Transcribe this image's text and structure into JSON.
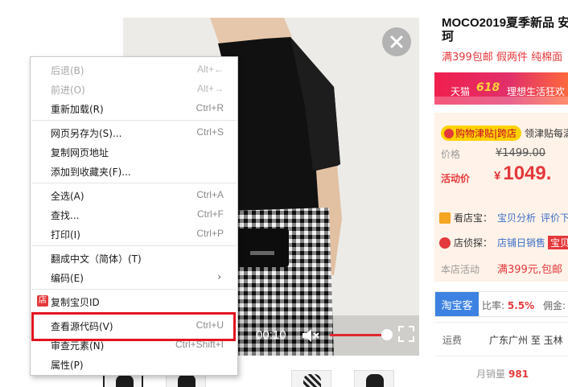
{
  "product": {
    "title": "MOCO2019夏季新品 安珂",
    "subtitle": "满399包邮 假两件 纯棉面"
  },
  "video": {
    "time": "00:10",
    "volume_level": 0.82
  },
  "banner": {
    "tmall": "天猫",
    "logo": "618",
    "slogan": "理想生活狂欢"
  },
  "coupon": {
    "tag": "购物津贴|跨店",
    "tail": "领津贴每满"
  },
  "prices": {
    "price_label": "价格",
    "original": "¥1499.00",
    "activity_label": "活动价",
    "currency": "¥",
    "activity_price": "1049."
  },
  "services": [
    {
      "label": "看店宝：",
      "links": [
        "宝贝分析",
        "评价下"
      ],
      "badge": ""
    },
    {
      "label": "店侦探：",
      "links": [
        "店铺日销售"
      ],
      "badge": "宝贝"
    }
  ],
  "shop_activity": {
    "label": "本店活动",
    "value": "满399元,包邮"
  },
  "taoke": {
    "button": "淘宝客",
    "ratio_label": "比率:",
    "ratio_value": "5.5%",
    "commission_label": "佣金:"
  },
  "shipping": {
    "label": "运费",
    "value": "广东广州 至 玉林"
  },
  "sales": {
    "label": "月销量",
    "value": "981"
  },
  "context_menu": [
    {
      "label": "后退(B)",
      "shortcut": "Alt+←",
      "disabled": true
    },
    {
      "label": "前进(O)",
      "shortcut": "Alt+→",
      "disabled": true
    },
    {
      "label": "重新加载(R)",
      "shortcut": "Ctrl+R",
      "disabled": false
    },
    {
      "label": "网页另存为(S)...",
      "shortcut": "Ctrl+S",
      "disabled": false
    },
    {
      "label": "复制网页地址",
      "shortcut": "",
      "disabled": false
    },
    {
      "label": "添加到收藏夹(F)...",
      "shortcut": "",
      "disabled": false
    },
    {
      "label": "全选(A)",
      "shortcut": "Ctrl+A",
      "disabled": false
    },
    {
      "label": "查找...",
      "shortcut": "Ctrl+F",
      "disabled": false
    },
    {
      "label": "打印(I)",
      "shortcut": "Ctrl+P",
      "disabled": false
    },
    {
      "label": "翻成中文（简体）(T)",
      "shortcut": "",
      "disabled": false
    },
    {
      "label": "编码(E)",
      "shortcut": "",
      "disabled": false,
      "submenu": "›"
    },
    {
      "label": "复制宝贝ID",
      "shortcut": "",
      "disabled": false,
      "icon": "店"
    },
    {
      "label": "查看源代码(V)",
      "shortcut": "Ctrl+U",
      "disabled": false
    },
    {
      "label": "审查元素(N)",
      "shortcut": "Ctrl+Shift+I",
      "disabled": false
    },
    {
      "label": "属性(P)",
      "shortcut": "",
      "disabled": false
    }
  ],
  "colors": {
    "accent_red": "#e4393c",
    "highlight_box": "#e3141f",
    "taoke_blue": "#3d82e2"
  }
}
